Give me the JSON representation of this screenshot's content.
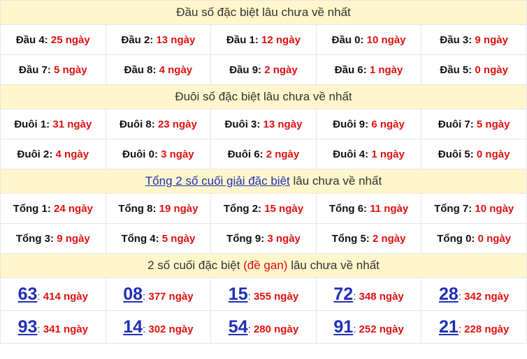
{
  "dau": {
    "title": "Đầu số đặc biệt lâu chưa về nhất",
    "rows": [
      [
        {
          "label": "Đầu 4:",
          "value": "25 ngày"
        },
        {
          "label": "Đầu 2:",
          "value": "13 ngày"
        },
        {
          "label": "Đầu 1:",
          "value": "12 ngày"
        },
        {
          "label": "Đầu 0:",
          "value": "10 ngày"
        },
        {
          "label": "Đầu 3:",
          "value": "9 ngày"
        }
      ],
      [
        {
          "label": "Đầu 7:",
          "value": "5 ngày"
        },
        {
          "label": "Đầu 8:",
          "value": "4 ngày"
        },
        {
          "label": "Đầu 9:",
          "value": "2 ngày"
        },
        {
          "label": "Đầu 6:",
          "value": "1 ngày"
        },
        {
          "label": "Đầu 5:",
          "value": "0 ngày"
        }
      ]
    ]
  },
  "duoi": {
    "title": "Đuôi số đặc biệt lâu chưa về nhất",
    "rows": [
      [
        {
          "label": "Đuôi 1:",
          "value": "31 ngày"
        },
        {
          "label": "Đuôi 8:",
          "value": "23 ngày"
        },
        {
          "label": "Đuôi 3:",
          "value": "13 ngày"
        },
        {
          "label": "Đuôi 9:",
          "value": "6 ngày"
        },
        {
          "label": "Đuôi 7:",
          "value": "5 ngày"
        }
      ],
      [
        {
          "label": "Đuôi 2:",
          "value": "4 ngày"
        },
        {
          "label": "Đuôi 0:",
          "value": "3 ngày"
        },
        {
          "label": "Đuôi 6:",
          "value": "2 ngày"
        },
        {
          "label": "Đuôi 4:",
          "value": "1 ngày"
        },
        {
          "label": "Đuôi 5:",
          "value": "0 ngày"
        }
      ]
    ]
  },
  "tong": {
    "title_link": "Tổng 2 số cuối giải đặc biệt",
    "title_rest": " lâu chưa về nhất",
    "rows": [
      [
        {
          "label": "Tổng 1:",
          "value": "24 ngày"
        },
        {
          "label": "Tổng 8:",
          "value": "19 ngày"
        },
        {
          "label": "Tổng 2:",
          "value": "15 ngày"
        },
        {
          "label": "Tổng 6:",
          "value": "11 ngày"
        },
        {
          "label": "Tổng 7:",
          "value": "10 ngày"
        }
      ],
      [
        {
          "label": "Tổng 3:",
          "value": "9 ngày"
        },
        {
          "label": "Tổng 4:",
          "value": "5 ngày"
        },
        {
          "label": "Tổng 9:",
          "value": "3 ngày"
        },
        {
          "label": "Tổng 5:",
          "value": "2 ngày"
        },
        {
          "label": "Tổng 0:",
          "value": "0 ngày"
        }
      ]
    ]
  },
  "gan": {
    "title_pre": "2 số cuối đặc biệt ",
    "title_red": "(đề gan)",
    "title_post": " lâu chưa về nhất",
    "rows": [
      [
        {
          "num": "63",
          "value": "414 ngày"
        },
        {
          "num": "08",
          "value": "377 ngày"
        },
        {
          "num": "15",
          "value": "355 ngày"
        },
        {
          "num": "72",
          "value": "348 ngày"
        },
        {
          "num": "28",
          "value": "342 ngày"
        }
      ],
      [
        {
          "num": "93",
          "value": "341 ngày"
        },
        {
          "num": "14",
          "value": "302 ngày"
        },
        {
          "num": "54",
          "value": "280 ngày"
        },
        {
          "num": "91",
          "value": "252 ngày"
        },
        {
          "num": "21",
          "value": "228 ngày"
        }
      ]
    ]
  },
  "colors": {
    "header_bg": "#fff6cc",
    "red": "#e01010",
    "blue": "#1f2fb5"
  }
}
